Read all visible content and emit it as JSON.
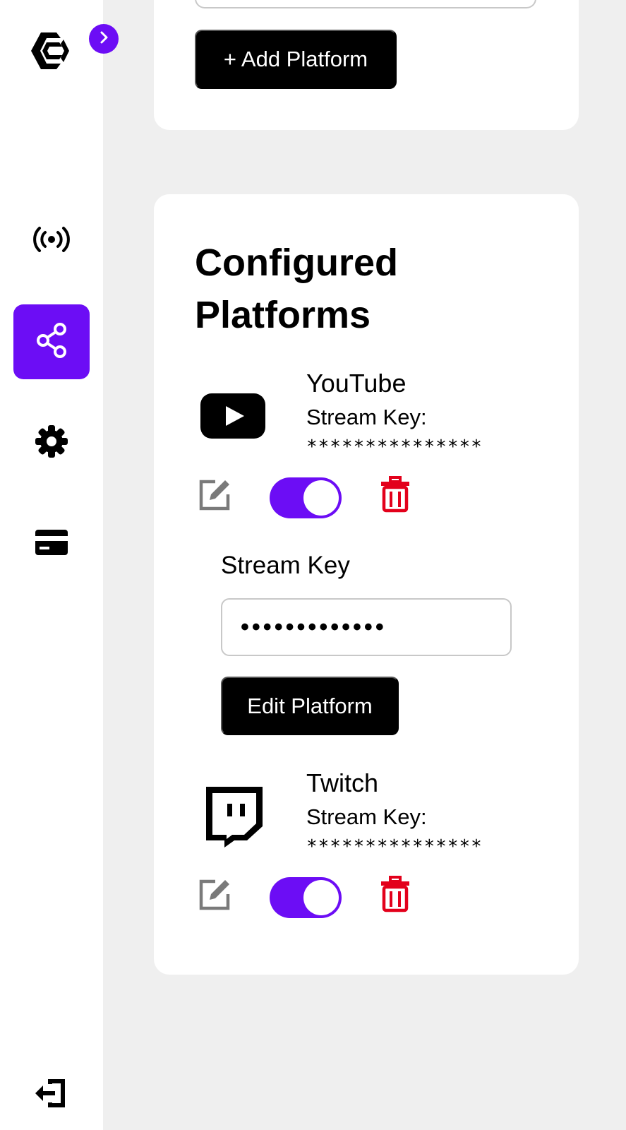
{
  "sidebar": {
    "logo": "brand-logo",
    "expand_icon": "chevron-right-icon",
    "items": [
      {
        "icon": "broadcast-icon",
        "active": false
      },
      {
        "icon": "share-icon",
        "active": true
      },
      {
        "icon": "gear-icon",
        "active": false
      },
      {
        "icon": "credit-card-icon",
        "active": false
      }
    ],
    "logout_icon": "logout-icon"
  },
  "add_card": {
    "add_button_label": "+ Add Platform"
  },
  "configured": {
    "title": "Configured Platforms",
    "platforms": [
      {
        "name": "YouTube",
        "icon": "youtube-icon",
        "key_label": "Stream Key:",
        "key_masked": "***************",
        "enabled": true
      },
      {
        "name": "Twitch",
        "icon": "twitch-icon",
        "key_label": "Stream Key:",
        "key_masked": "***************",
        "enabled": true
      }
    ],
    "edit_form": {
      "label": "Stream Key",
      "value": "•••••••••••••",
      "submit_label": "Edit Platform"
    }
  },
  "colors": {
    "accent": "#6c0df5",
    "danger": "#e3001b",
    "muted_icon": "#7a7a7a",
    "background": "#efefef"
  }
}
